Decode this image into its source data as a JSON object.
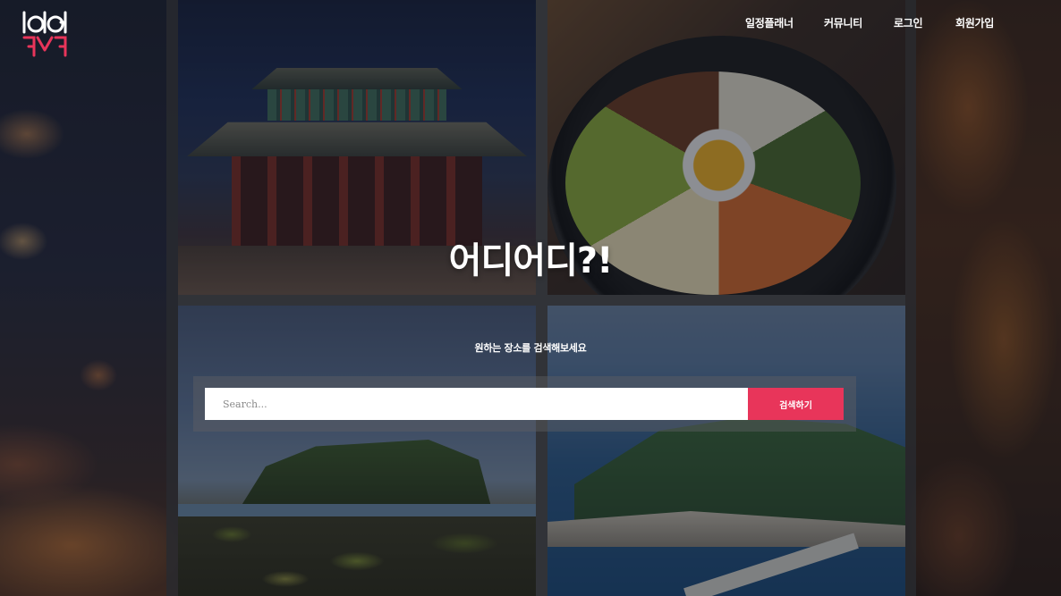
{
  "logo": {
    "icon": "logo-icon",
    "colors": {
      "primary": "#ffffff",
      "accent": "#e8355a"
    }
  },
  "nav": {
    "items": [
      {
        "label": "일정플래너"
      },
      {
        "label": "커뮤니티"
      },
      {
        "label": "로그인"
      },
      {
        "label": "회원가입"
      }
    ]
  },
  "hero": {
    "title": "어디어디?!",
    "subtitle": "원하는 장소를 검색해보세요"
  },
  "search": {
    "placeholder": "Search...",
    "value": "",
    "button_label": "검색하기"
  },
  "colors": {
    "accent": "#e8355a",
    "text": "#ffffff",
    "divider": "#4c4c4c"
  }
}
